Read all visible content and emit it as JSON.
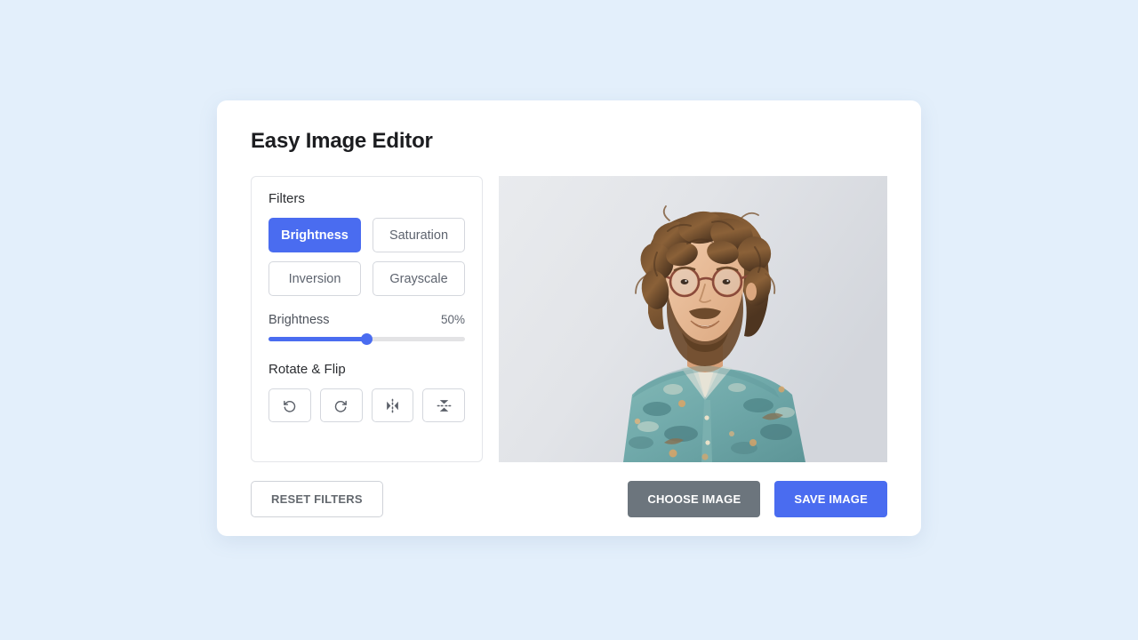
{
  "app": {
    "title": "Easy Image Editor",
    "background_color": "#e3effb",
    "card_color": "#ffffff",
    "accent_color": "#4a6cf0",
    "secondary_color": "#6c757d"
  },
  "filters": {
    "section_label": "Filters",
    "buttons": [
      {
        "label": "Brightness",
        "active": true
      },
      {
        "label": "Saturation",
        "active": false
      },
      {
        "label": "Inversion",
        "active": false
      },
      {
        "label": "Grayscale",
        "active": false
      }
    ],
    "slider": {
      "name": "Brightness",
      "value_label": "50%",
      "value": 50,
      "min": 0,
      "max": 100
    }
  },
  "rotate_flip": {
    "section_label": "Rotate & Flip",
    "buttons": [
      {
        "icon": "rotate-left-icon",
        "name": "rotate-left-button"
      },
      {
        "icon": "rotate-right-icon",
        "name": "rotate-right-button"
      },
      {
        "icon": "flip-horizontal-icon",
        "name": "flip-horizontal-button"
      },
      {
        "icon": "flip-vertical-icon",
        "name": "flip-vertical-button"
      }
    ]
  },
  "preview": {
    "alt": "Portrait photo of a smiling bearded man with curly hair, glasses and a teal floral shirt on a light gray background"
  },
  "footer": {
    "reset_label": "RESET FILTERS",
    "choose_label": "CHOOSE IMAGE",
    "save_label": "SAVE IMAGE"
  }
}
